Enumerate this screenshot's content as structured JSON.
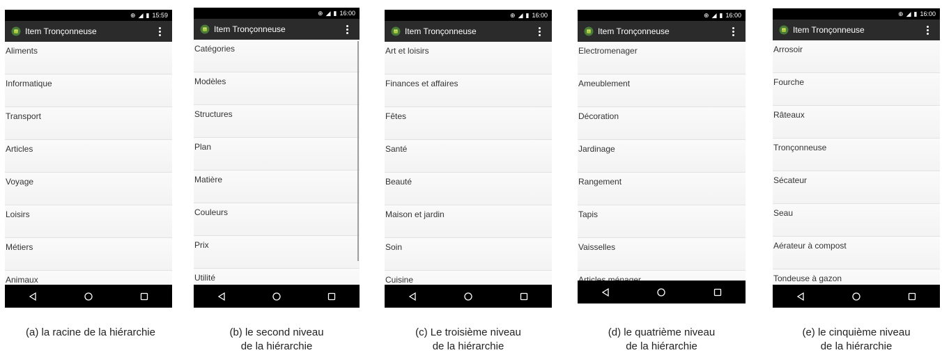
{
  "app_title": "Item Tronçonneuse",
  "phones": [
    {
      "time": "15:59",
      "items": [
        "Aliments",
        "Informatique",
        "Transport",
        "Articles",
        "Voyage",
        "Loisirs",
        "Métiers",
        "Animaux"
      ],
      "caption": [
        "(a) la racine de la hiérarchie"
      ]
    },
    {
      "time": "16:00",
      "items": [
        "Catégories",
        "Modèles",
        "Structures",
        "Plan",
        "Matière",
        "Couleurs",
        "Prix",
        "Utilité"
      ],
      "caption": [
        "(b) le second niveau",
        "de la hiérarchie"
      ]
    },
    {
      "time": "16:00",
      "items": [
        "Art et loisirs",
        "Finances et affaires",
        "Fêtes",
        "Santé",
        "Beauté",
        "Maison et jardin",
        "Soin",
        "Cuisine"
      ],
      "caption": [
        "(c) Le troisième niveau",
        "de la hiérarchie"
      ]
    },
    {
      "time": "16:00",
      "items": [
        "Electromenager",
        "Ameublement",
        "Décoration",
        "Jardinage",
        "Rangement",
        "Tapis",
        "Vaisselles",
        "Articles ménager"
      ],
      "caption": [
        "(d) le quatrième niveau",
        "de la hiérarchie"
      ]
    },
    {
      "time": "16:00",
      "items": [
        "Arrosoir",
        "Fourche",
        "Râteaux",
        "Tronçonneuse",
        "Sécateur",
        "Seau",
        "Aérateur à compost",
        "Tondeuse à gazon"
      ],
      "caption": [
        "(e) le cinquième niveau",
        "de la hiérarchie"
      ]
    }
  ]
}
